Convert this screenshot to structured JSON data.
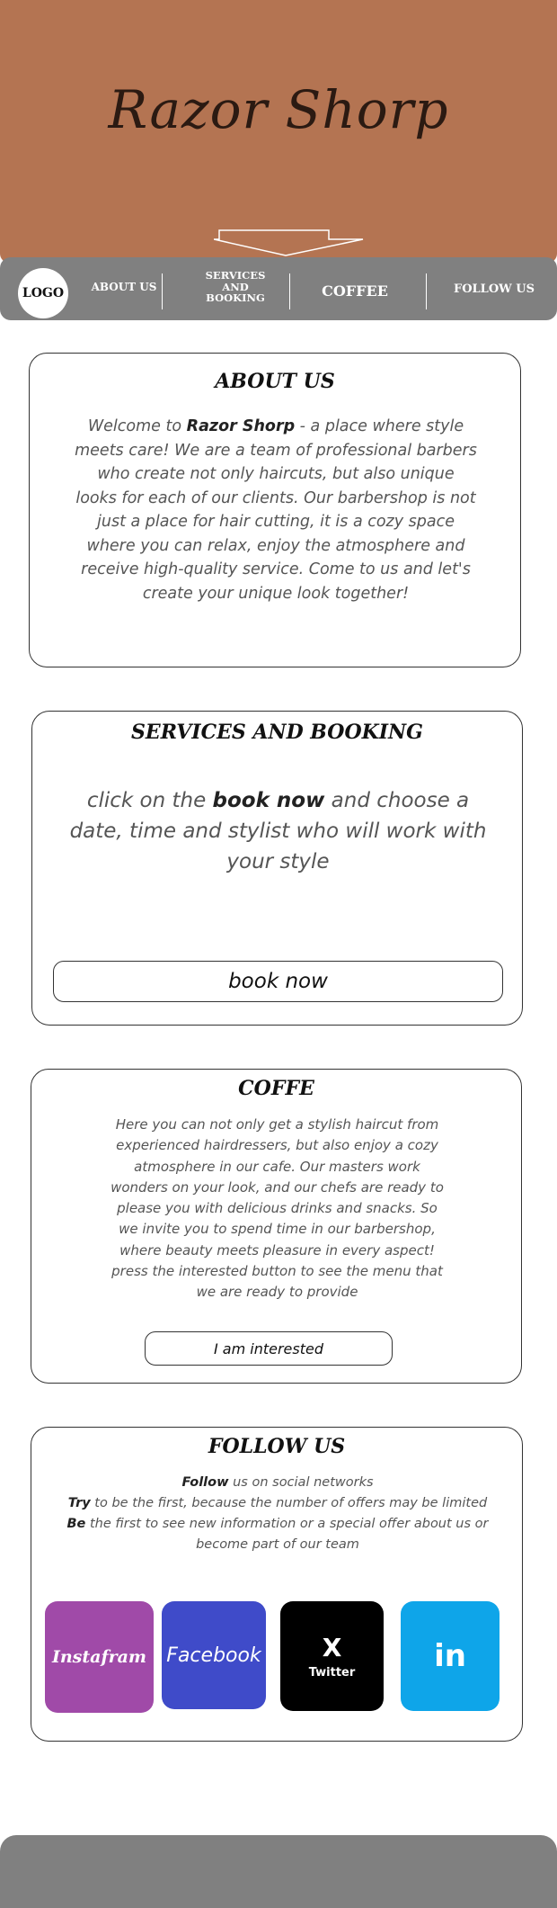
{
  "hero": {
    "brand": "Razor Shorp"
  },
  "nav": {
    "logo": "LOGO",
    "about": "ABOUT US",
    "services_line1": "SERVICES",
    "services_line2": "AND",
    "services_line3": "BOOKING",
    "coffee": "COFFEE",
    "follow": "FOLLOW US"
  },
  "about": {
    "title": "ABOUT US",
    "welcome": "Welcome to ",
    "brand": "Razor Shorp",
    "rest": " - a place where style meets care! We are a team of professional barbers who create not only haircuts, but also unique looks for each of our clients. Our barbershop is not just a place for hair cutting, it is a cozy space where you can relax, enjoy the atmosphere and receive high-quality service. Come to us and let's create your unique look together!"
  },
  "services": {
    "title": "SERVICES AND BOOKING",
    "text_before": "click on the ",
    "text_bold": "book now",
    "text_after": " and choose a date, time and stylist who will work with your style",
    "button": "book now"
  },
  "coffee": {
    "title": "COFFE",
    "text": "Here you can not only get a stylish haircut from experienced hairdressers, but also enjoy a cozy atmosphere in our cafe. Our masters work wonders on your look, and our chefs are ready to please you with delicious drinks and snacks. So we invite you to spend time in our barbershop, where beauty meets pleasure in every aspect! press the interested button to see the menu that we are ready to provide",
    "button": "I am interested"
  },
  "follow": {
    "title": "FOLLOW US",
    "line1_bold": "Follow",
    "line1_rest": " us on social networks",
    "line2_bold": "Try",
    "line2_rest": " to be the first, because the number of offers may be limited",
    "line3_bold": "Be",
    "line3_rest": " the first to see new information or a special offer about us or become part of our team"
  },
  "social": {
    "instagram": {
      "label": "Instafram",
      "color": "#a04aa8"
    },
    "facebook": {
      "label": "Facebook",
      "color": "#3f4bc9"
    },
    "twitter": {
      "symbol": "X",
      "label": "Twitter",
      "color": "#000000"
    },
    "linkedin": {
      "symbol": "in",
      "color": "#0ea5e9"
    }
  },
  "colors": {
    "hero_bg": "#b47452",
    "nav_bg": "#808080",
    "footer_bg": "#808080"
  }
}
